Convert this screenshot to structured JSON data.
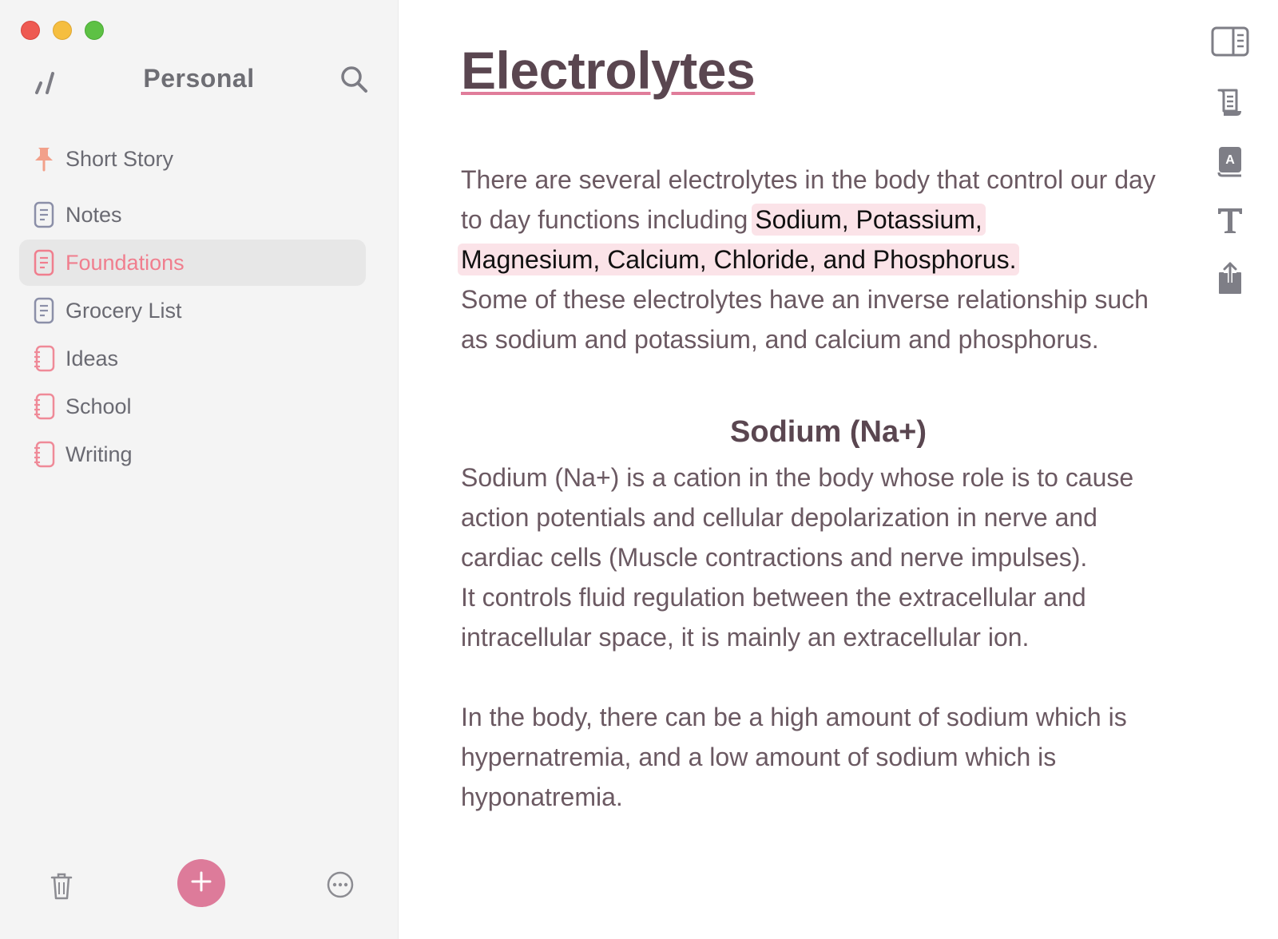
{
  "window": {
    "controls": [
      "close",
      "minimize",
      "zoom"
    ]
  },
  "sidebar": {
    "title": "Personal",
    "header_icons": [
      "app-logo-icon",
      "search-icon"
    ],
    "items": [
      {
        "label": "Short Story",
        "icon": "pin-icon",
        "pinned": true,
        "selected": false
      },
      {
        "label": "Notes",
        "icon": "sheet-icon",
        "selected": false
      },
      {
        "label": "Foundations",
        "icon": "sheet-icon",
        "selected": true
      },
      {
        "label": "Grocery List",
        "icon": "sheet-icon",
        "selected": false
      },
      {
        "label": "Ideas",
        "icon": "notebook-icon",
        "selected": false
      },
      {
        "label": "School",
        "icon": "notebook-icon",
        "selected": false
      },
      {
        "label": "Writing",
        "icon": "notebook-icon",
        "selected": false
      }
    ],
    "footer_icons": [
      "trash-icon",
      "add-icon",
      "more-icon"
    ]
  },
  "document": {
    "title": "Electrolytes",
    "intro_before": "There are several electrolytes in the body that control our day to day functions including ",
    "intro_highlight_1": "Sodium, Potassium,",
    "intro_highlight_2": "Magnesium, Calcium, Chloride, and Phosphorus.",
    "intro_after": "Some of these electrolytes have an inverse relationship such as sodium and potassium, and calcium and phosphorus.",
    "section_heading": "Sodium (Na+)",
    "sodium_para_1": "Sodium (Na+) is a cation in the body whose role is to cause action potentials and cellular depolarization in nerve and cardiac cells (Muscle contractions and nerve impulses).",
    "sodium_para_2": "It controls fluid regulation between the extracellular and intracellular space, it is mainly an extracellular ion.",
    "sodium_para_3": "In the body, there can be a high amount of sodium which is hypernatremia, and a low amount of sodium which is hyponatremia."
  },
  "toolbar": {
    "icons": [
      "preview-panel-icon",
      "scroll-icon",
      "dictionary-icon",
      "typography-icon",
      "share-icon"
    ]
  },
  "colors": {
    "accent": "#f07e8e",
    "add_button": "#dd7b9a",
    "highlight": "#fbe3e8",
    "title": "#5a4650",
    "body_text": "#6b5962"
  }
}
